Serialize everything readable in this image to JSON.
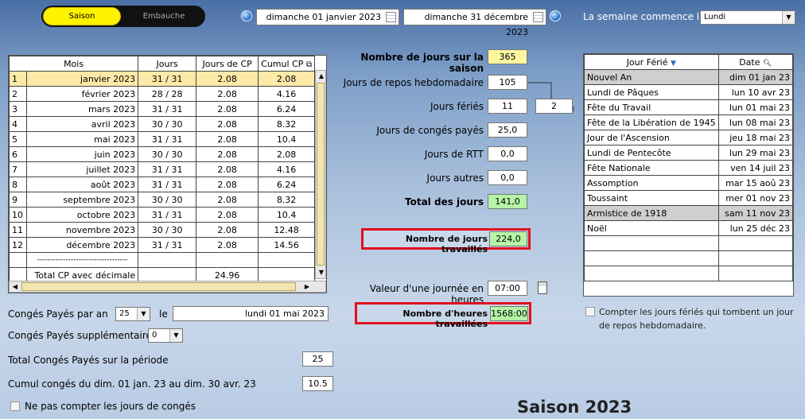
{
  "topbar": {
    "toggle_on": "Saison",
    "toggle_off": "Embauche",
    "date_start": "dimanche 01 janvier 2023",
    "date_end": "dimanche 31 décembre 2023",
    "week_label": "La semaine commence le",
    "week_value": "Lundi"
  },
  "months_table": {
    "headers": [
      "Mois",
      "Jours",
      "Jours de CP",
      "Cumul CP"
    ],
    "rows": [
      [
        "1",
        "janvier 2023",
        "31 / 31",
        "2.08",
        "2.08"
      ],
      [
        "2",
        "février 2023",
        "28 / 28",
        "2.08",
        "4.16"
      ],
      [
        "3",
        "mars 2023",
        "31 / 31",
        "2.08",
        "6.24"
      ],
      [
        "4",
        "avril 2023",
        "30 / 30",
        "2.08",
        "8.32"
      ],
      [
        "5",
        "mai 2023",
        "31 / 31",
        "2.08",
        "10.4"
      ],
      [
        "6",
        "juin 2023",
        "30 / 30",
        "2.08",
        "2.08"
      ],
      [
        "7",
        "juillet 2023",
        "31 / 31",
        "2.08",
        "4.16"
      ],
      [
        "8",
        "août 2023",
        "31 / 31",
        "2.08",
        "6.24"
      ],
      [
        "9",
        "septembre 2023",
        "30 / 30",
        "2.08",
        "8.32"
      ],
      [
        "10",
        "octobre 2023",
        "31 / 31",
        "2.08",
        "10.4"
      ],
      [
        "11",
        "novembre 2023",
        "30 / 30",
        "2.08",
        "12.48"
      ],
      [
        "12",
        "décembre 2023",
        "31 / 31",
        "2.08",
        "14.56"
      ]
    ],
    "separator": "-----------------------------------",
    "total_label": "Total CP avec décimale",
    "total_value": "24.96"
  },
  "conges": {
    "par_an_label": "Congés Payés par an",
    "par_an_value": "25",
    "le_label": "le",
    "le_date": "lundi 01 mai 2023",
    "supp_label": "Congés Payés supplémentaires",
    "supp_value": "0",
    "total_label": "Total Congés Payés sur la période",
    "total_value": "25",
    "cumul_label": "Cumul congés du dim. 01 jan. 23 au dim. 30 avr. 23",
    "cumul_value": "10.5",
    "no_count_label": "Ne pas compter les jours de congés"
  },
  "stats": {
    "saison_label": "Nombre de jours sur la saison",
    "saison_value": "365",
    "repos_label": "Jours de repos hebdomadaire",
    "repos_value": "105",
    "feries_label": "Jours fériés",
    "feries_value": "11",
    "feries_extra": "2",
    "cp_label": "Jours de congés payés",
    "cp_value": "25,0",
    "rtt_label": "Jours de RTT",
    "rtt_value": "0,0",
    "autres_label": "Jours autres",
    "autres_value": "0,0",
    "total_label": "Total des jours",
    "total_value": "141,0",
    "travailles_label": "Nombre de jours travaillés",
    "travailles_value": "224,0",
    "journee_label": "Valeur d'une journée en heures",
    "journee_value": "07:00",
    "heures_label": "Nombre d'heures travaillées",
    "heures_value": "1568:00"
  },
  "holidays": {
    "headers": [
      "Jour Férié",
      "Date"
    ],
    "rows": [
      [
        "Nouvel An",
        "dim 01 jan 23"
      ],
      [
        "Lundi de Pâques",
        "lun 10 avr 23"
      ],
      [
        "Fête du Travail",
        "lun 01 mai 23"
      ],
      [
        "Fête de la Libération de 1945",
        "lun 08 mai 23"
      ],
      [
        "Jour de l'Ascension",
        "jeu 18 mai 23"
      ],
      [
        "Lundi de Pentecôte",
        "lun 29 mai 23"
      ],
      [
        "Fête Nationale",
        "ven 14 juil 23"
      ],
      [
        "Assomption",
        "mar 15 aoû 23"
      ],
      [
        "Toussaint",
        "mer 01 nov 23"
      ],
      [
        "Armistice de 1918",
        "sam 11 nov 23"
      ],
      [
        "Noël",
        "lun 25 déc 23"
      ]
    ],
    "checkbox_label": "Compter les jours fériés qui tombent un jour de repos hebdomadaire."
  },
  "footer_title": "Saison 2023"
}
